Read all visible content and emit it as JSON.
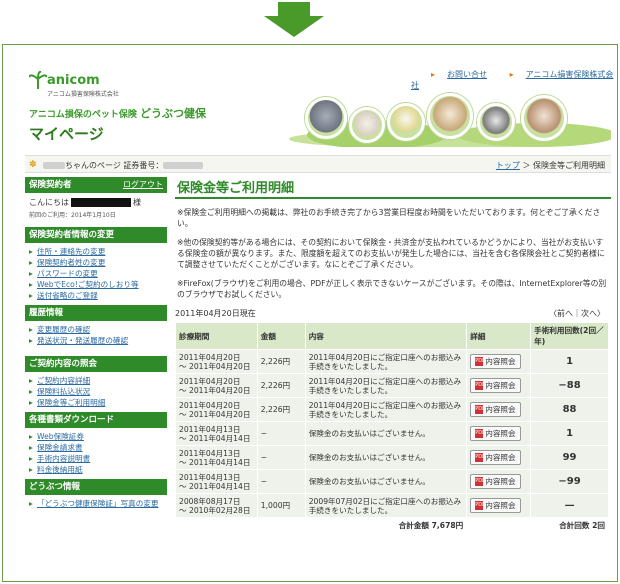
{
  "header": {
    "logo_text": "anicom",
    "logo_sub": "アニコム損害保険株式会社",
    "tagline_small": "アニコム損保のペット保険",
    "tagline_big": "どうぶつ健保",
    "page_title": "マイページ",
    "links": [
      "お問い合せ",
      "アニコム損害保険株式会社"
    ]
  },
  "userbar": {
    "suffix": "ちゃんのページ",
    "cert_label": "証券番号：",
    "crumb_top": "トップ",
    "crumb_sep": "＞",
    "crumb_current": "保険金等ご利用明細"
  },
  "sidebar": {
    "head1": "保険契約者",
    "logout": "ログアウト",
    "greeting": "こんにちは",
    "greeting_suffix": "様",
    "last_login": "前回のご利用：2014年1月10日",
    "head2": "保険契約者情報の変更",
    "list2": [
      "住所・連絡先の変更",
      "保険契約者姓の変更",
      "パスワードの変更",
      "WebでEco!ご契約のしおり等",
      "送付省略のご登録"
    ],
    "head3": "履歴情報",
    "list3": [
      "変更履歴の確認",
      "発送状況・発送履歴の確認"
    ],
    "head4": "ご契約内容の照会",
    "list4": [
      "ご契約内容詳細",
      "保険料払込状況",
      "保険金等ご利用明細"
    ],
    "head5": "各種書類ダウンロード",
    "list5": [
      "Web保険証券",
      "保険金請求書",
      "手術内容説明書",
      "料金後納用紙"
    ],
    "head6": "どうぶつ情報",
    "list6": [
      "「どうぶつ健康保険証」写真の変更"
    ]
  },
  "main": {
    "title": "保険金等ご利用明細",
    "note1": "※保険金ご利用明細への掲載は、弊社のお手続き完了から3営業日程度お時間をいただいております。何とぞご了承ください。",
    "note2": "※他の保険契約等がある場合には、その契約において保険金・共済金が支払われているかどうかにより、当社がお支払いする保険金の額が異なります。また、限度額を超えてのお支払いが発生した場合には、当社を含む各保険会社とご契約者様にて調整させていただくことがございます。なにとぞご了承ください。",
    "note3": "※FireFox(ブラウザ)をご利用の場合、PDFが正しく表示できないケースがございます。その際は、InternetExplorer等の別のブラウザでお試しください。",
    "as_of": "2011年04月20日現在",
    "pager": "〈前へ｜次へ〉",
    "columns": [
      "診療期間",
      "金額",
      "内容",
      "詳細",
      "手術利用回数(2回／年)"
    ],
    "detail_label": "内容照会",
    "rows": [
      {
        "period1": "2011年04月20日",
        "period2": "～ 2011年04月20日",
        "amount": "2,226円",
        "content": "2011年04月20日にご指定口座へのお振込み手続きをいたしました。",
        "count": "1"
      },
      {
        "period1": "2011年04月20日",
        "period2": "～ 2011年04月20日",
        "amount": "2,226円",
        "content": "2011年04月20日にご指定口座へのお振込み手続きをいたしました。",
        "count": "−88"
      },
      {
        "period1": "2011年04月20日",
        "period2": "～ 2011年04月20日",
        "amount": "2,226円",
        "content": "2011年04月20日にご指定口座へのお振込み手続きをいたしました。",
        "count": "88"
      },
      {
        "period1": "2011年04月13日",
        "period2": "～ 2011年04月14日",
        "amount": "−",
        "content": "保険金のお支払いはございません。",
        "count": "1"
      },
      {
        "period1": "2011年04月13日",
        "period2": "～ 2011年04月14日",
        "amount": "−",
        "content": "保険金のお支払いはございません。",
        "count": "99"
      },
      {
        "period1": "2011年04月13日",
        "period2": "～ 2011年04月14日",
        "amount": "−",
        "content": "保険金のお支払いはございません。",
        "count": "−99"
      },
      {
        "period1": "2008年08月17日",
        "period2": "～ 2010年02月28日",
        "amount": "1,000円",
        "content": "2009年07月02日にご指定口座へのお振込み手続きをいたしました。",
        "count": "—"
      }
    ],
    "total_amount_label": "合計金額",
    "total_amount": "7,678円",
    "total_count_label": "合計回数",
    "total_count": "2回"
  },
  "colors": {
    "brand_green": "#2f8a2a",
    "link_blue": "#2a6aa0",
    "header_row": "#d8e8c8"
  }
}
